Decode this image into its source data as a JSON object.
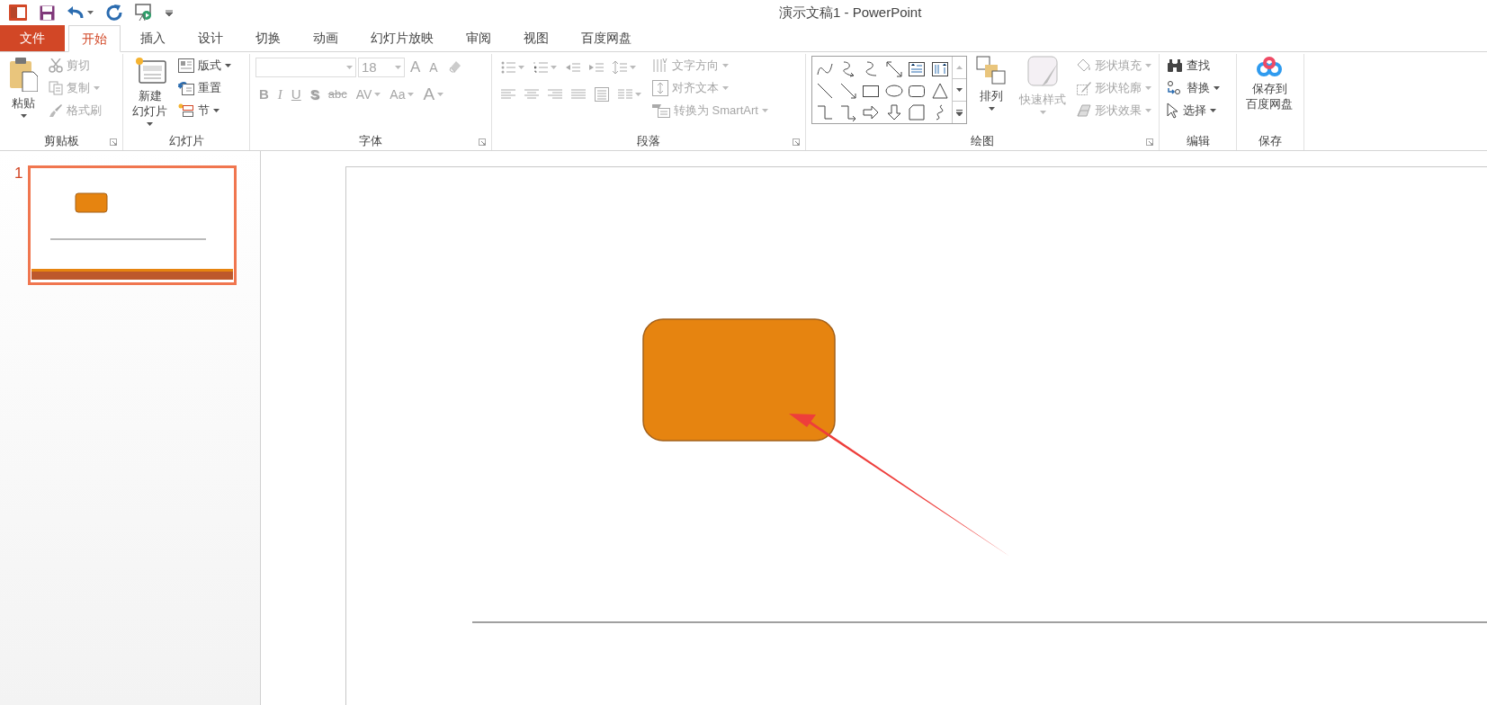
{
  "window": {
    "title": "演示文稿1 - PowerPoint"
  },
  "tabs": [
    {
      "label": "文件",
      "kind": "file",
      "selected": false
    },
    {
      "label": "开始",
      "kind": "tab",
      "selected": true
    },
    {
      "label": "插入",
      "kind": "tab",
      "selected": false
    },
    {
      "label": "设计",
      "kind": "tab",
      "selected": false
    },
    {
      "label": "切换",
      "kind": "tab",
      "selected": false
    },
    {
      "label": "动画",
      "kind": "tab",
      "selected": false
    },
    {
      "label": "幻灯片放映",
      "kind": "tab",
      "selected": false
    },
    {
      "label": "审阅",
      "kind": "tab",
      "selected": false
    },
    {
      "label": "视图",
      "kind": "tab",
      "selected": false
    },
    {
      "label": "百度网盘",
      "kind": "tab",
      "selected": false
    }
  ],
  "ribbon": [
    {
      "label": "剪贴板",
      "launcher": true,
      "columns": [
        [
          {
            "kind": "large",
            "lines": [
              "粘贴"
            ],
            "dropdown": true,
            "disabled": false
          }
        ],
        [
          {
            "kind": "small",
            "label": "剪切",
            "dropdown": false,
            "disabled": true
          },
          {
            "kind": "small",
            "label": "复制",
            "dropdown": true,
            "disabled": true
          },
          {
            "kind": "small",
            "label": "格式刷",
            "dropdown": false,
            "disabled": true
          }
        ]
      ]
    },
    {
      "label": "幻灯片",
      "launcher": false,
      "columns": [
        [
          {
            "kind": "large",
            "lines": [
              "新建",
              "幻灯片"
            ],
            "dropdown": true,
            "disabled": false
          }
        ],
        [
          {
            "kind": "small",
            "label": "版式",
            "dropdown": true,
            "disabled": false
          },
          {
            "kind": "small",
            "label": "重置",
            "dropdown": false,
            "disabled": false
          },
          {
            "kind": "small",
            "label": "节",
            "dropdown": true,
            "disabled": false
          }
        ]
      ]
    },
    {
      "label": "字体",
      "launcher": true,
      "columns": [
        [
          {
            "kind": "toolrow",
            "items": [
              {
                "kind": "field",
                "dropdown": true,
                "disabled": true
              },
              {
                "kind": "field",
                "value": "18",
                "dropdown": true,
                "disabled": true
              },
              {
                "kind": "grow",
                "label": "A",
                "dropdown": false,
                "disabled": true
              },
              {
                "kind": "shrink",
                "label": "A",
                "dropdown": false,
                "disabled": true
              },
              {
                "kind": "tool",
                "dropdown": false,
                "disabled": true
              }
            ]
          },
          {
            "kind": "toolrow",
            "items": [
              {
                "kind": "bold",
                "label": "B",
                "dropdown": false,
                "disabled": true
              },
              {
                "kind": "italic",
                "label": "I",
                "dropdown": false,
                "disabled": true
              },
              {
                "kind": "underline",
                "label": "U",
                "dropdown": false,
                "disabled": true
              },
              {
                "kind": "shadow",
                "label": "S",
                "dropdown": false,
                "disabled": true
              },
              {
                "kind": "strike",
                "label": "abc",
                "dropdown": false,
                "disabled": true
              },
              {
                "kind": "spacing",
                "label": "AV",
                "dropdown": true,
                "disabled": true
              },
              {
                "kind": "case",
                "label": "Aa",
                "dropdown": true,
                "disabled": true
              },
              {
                "kind": "color",
                "label": "A",
                "dropdown": true,
                "disabled": true
              }
            ]
          }
        ]
      ]
    },
    {
      "label": "段落",
      "launcher": true,
      "columns": [
        [
          {
            "kind": "toolrow",
            "items": [
              {
                "kind": "tool",
                "dropdown": true,
                "disabled": true
              },
              {
                "kind": "tool",
                "dropdown": true,
                "disabled": true
              },
              {
                "kind": "tool",
                "dropdown": false,
                "disabled": true
              },
              {
                "kind": "tool",
                "dropdown": false,
                "disabled": true
              },
              {
                "kind": "tool",
                "dropdown": true,
                "disabled": true
              }
            ]
          },
          {
            "kind": "toolrow",
            "items": [
              {
                "kind": "tool",
                "dropdown": false,
                "disabled": true
              },
              {
                "kind": "tool",
                "dropdown": false,
                "disabled": true
              },
              {
                "kind": "tool",
                "dropdown": false,
                "disabled": true
              },
              {
                "kind": "tool",
                "dropdown": false,
                "disabled": true
              },
              {
                "kind": "tool",
                "dropdown": false,
                "disabled": true
              },
              {
                "kind": "tool",
                "dropdown": true,
                "disabled": true
              }
            ]
          }
        ],
        [
          {
            "kind": "small",
            "label": "文字方向",
            "dropdown": true,
            "disabled": true
          },
          {
            "kind": "small",
            "label": "对齐文本",
            "dropdown": true,
            "disabled": true
          },
          {
            "kind": "small",
            "label": "转换为 SmartArt",
            "dropdown": true,
            "disabled": true
          }
        ]
      ]
    },
    {
      "label": "绘图",
      "launcher": true,
      "columns": [
        [
          {
            "kind": "gallery"
          }
        ],
        [
          {
            "kind": "large",
            "lines": [
              "排列"
            ],
            "dropdown": true,
            "disabled": false
          }
        ],
        [
          {
            "kind": "large",
            "lines": [
              "快速样式"
            ],
            "dropdown": true,
            "disabled": true
          }
        ],
        [
          {
            "kind": "small",
            "label": "形状填充",
            "dropdown": true,
            "disabled": true
          },
          {
            "kind": "small",
            "label": "形状轮廓",
            "dropdown": true,
            "disabled": true
          },
          {
            "kind": "small",
            "label": "形状效果",
            "dropdown": true,
            "disabled": true
          }
        ]
      ]
    },
    {
      "label": "编辑",
      "launcher": false,
      "columns": [
        [
          {
            "kind": "small",
            "label": "查找",
            "dropdown": false,
            "disabled": false
          },
          {
            "kind": "small",
            "label": "替换",
            "dropdown": true,
            "disabled": false
          },
          {
            "kind": "small",
            "label": "选择",
            "dropdown": true,
            "disabled": false
          }
        ]
      ]
    },
    {
      "label": "保存",
      "launcher": false,
      "columns": [
        [
          {
            "kind": "large",
            "lines": [
              "保存到",
              "百度网盘"
            ],
            "dropdown": false,
            "disabled": false
          }
        ]
      ]
    }
  ],
  "slides": [
    {
      "number": "1",
      "selected": true
    }
  ]
}
